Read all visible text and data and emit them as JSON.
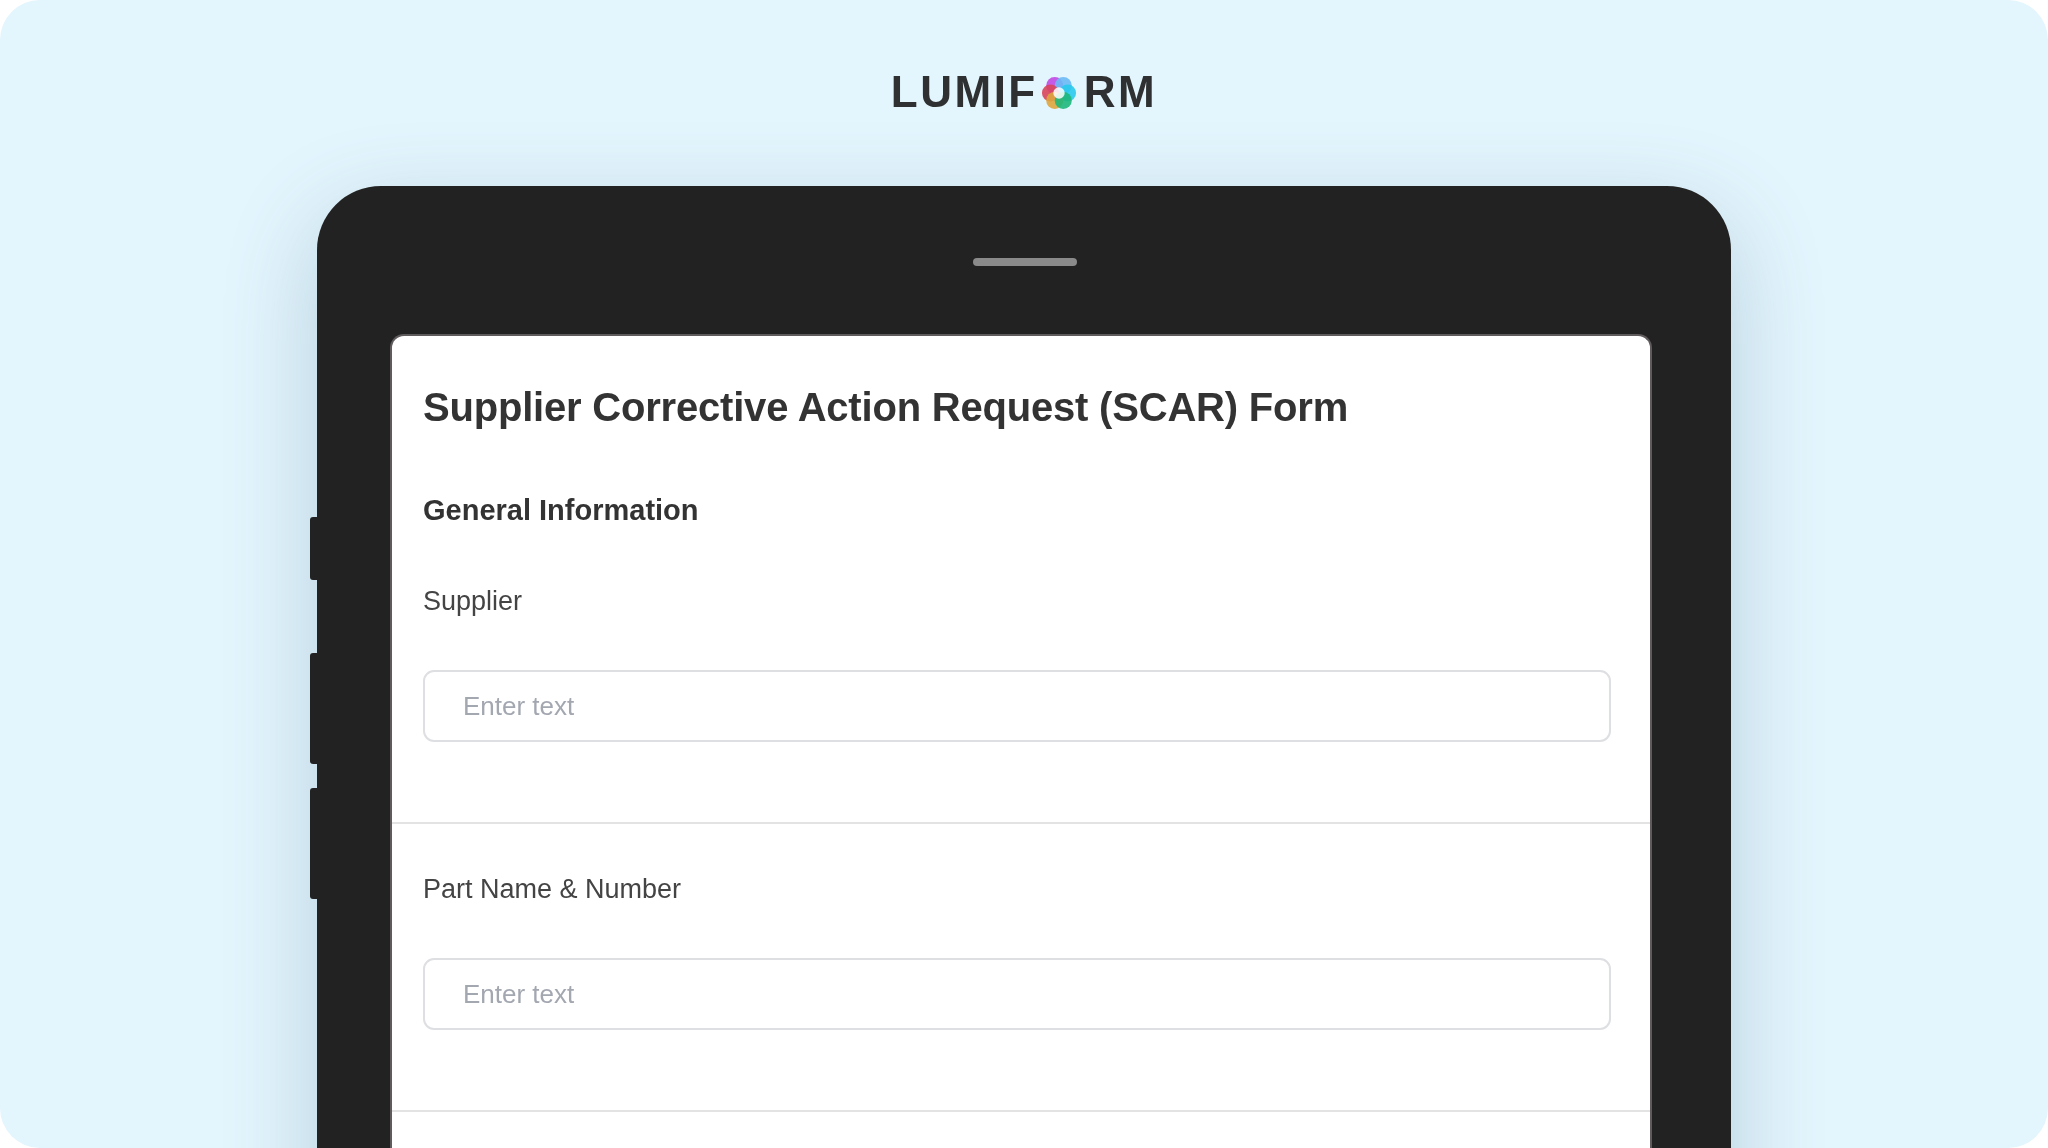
{
  "logo": {
    "text_before": "LUMIF",
    "text_after": "RM"
  },
  "form": {
    "title": "Supplier Corrective Action Request (SCAR) Form",
    "section_heading": "General Information",
    "fields": [
      {
        "label": "Supplier",
        "placeholder": "Enter text"
      },
      {
        "label": "Part Name & Number",
        "placeholder": "Enter text"
      }
    ]
  }
}
